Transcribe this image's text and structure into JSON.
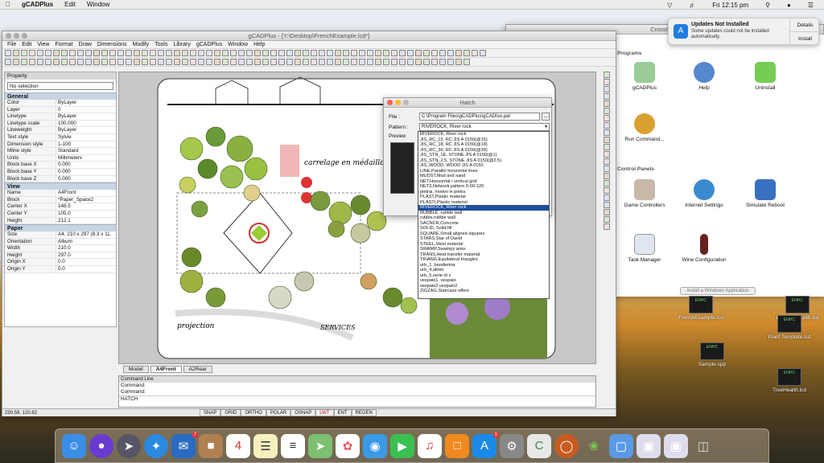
{
  "menubar": {
    "app_name": "gCADPlus",
    "items": [
      "Edit",
      "Window"
    ],
    "clock": "Fri 12:15 pm"
  },
  "notification": {
    "title": "Updates Not Installed",
    "body": "Some updates could not be installed automatically.",
    "details_label": "Details",
    "install_label": "Install"
  },
  "crossover": {
    "title": "CrossOver",
    "section_programs": "Programs",
    "section_control": "Control Panels",
    "programs": [
      "gCADPlus",
      "Help",
      "Uninstall",
      "Run Command..."
    ],
    "controls": [
      "Game Controllers",
      "Internet Settings",
      "Simulate Reboot",
      "Task Manager",
      "Wine Configuration"
    ],
    "install_button": "Install a Windows Application"
  },
  "desktop_files": [
    "FrenchExample.lcd",
    "PlanFromKeith.lcd",
    "Plant Template.lcd",
    "Sample.spp",
    "TreeHealth.lcd"
  ],
  "cad": {
    "title": "gCADPlus - [Y:\\Desktop\\FrenchExample.lcd*]",
    "menus": [
      "File",
      "Edit",
      "View",
      "Format",
      "Draw",
      "Dimensions",
      "Modify",
      "Tools",
      "Library",
      "gCADPlus",
      "Window",
      "Help"
    ],
    "property_title": "Property",
    "selection": "No selection",
    "general_title": "General",
    "general_rows": [
      {
        "k": "Color",
        "v": "ByLayer"
      },
      {
        "k": "Layer",
        "v": "0"
      },
      {
        "k": "Linetype",
        "v": "ByLayer"
      },
      {
        "k": "Linetype scale",
        "v": "100.000"
      },
      {
        "k": "Lineweight",
        "v": "ByLayer"
      },
      {
        "k": "Text style",
        "v": "Sylvie"
      },
      {
        "k": "Dimension style",
        "v": "1-100"
      },
      {
        "k": "Mline style",
        "v": "Standard"
      },
      {
        "k": "Units",
        "v": "Millimeters"
      },
      {
        "k": "Block base X",
        "v": "0.000"
      },
      {
        "k": "Block base Y",
        "v": "0.000"
      },
      {
        "k": "Block base Z",
        "v": "0.000"
      }
    ],
    "view_title": "View",
    "view_rows": [
      {
        "k": "Name",
        "v": "A4Front"
      },
      {
        "k": "Block",
        "v": "*Paper_Space2"
      },
      {
        "k": "Center X",
        "v": "148.5"
      },
      {
        "k": "Center Y",
        "v": "105.0"
      },
      {
        "k": "Height",
        "v": "212.1"
      }
    ],
    "paper_title": "Paper",
    "paper_rows": [
      {
        "k": "Size",
        "v": "A4, 210 x 297 (8.3 x 11."
      },
      {
        "k": "Orientation",
        "v": "Album"
      },
      {
        "k": "Width",
        "v": "210.0"
      },
      {
        "k": "Height",
        "v": "297.0"
      },
      {
        "k": "Origin X",
        "v": "0.0"
      },
      {
        "k": "Origin Y",
        "v": "0.0"
      }
    ],
    "tabs": [
      "Model",
      "A4Front",
      "A2Rear"
    ],
    "command_title": "Command Line",
    "command_lines": [
      "Command:",
      "Command:"
    ],
    "command_last": "HATCH",
    "coords": "230.58, 120.82",
    "status": [
      "SNAP",
      "GRID",
      "ORTHO",
      "POLAR",
      "OSNAP",
      "LWT",
      "ENT",
      "REGEN"
    ],
    "annotation_1": "carrelage en médaillon",
    "annotation_2": "projection",
    "annotation_3": "SERVICES"
  },
  "hatch": {
    "title": "Hatch",
    "file_label": "File :",
    "file_value": "C:\\Program Files\\gCADPlus\\gCADIso.pat",
    "pattern_label": "Pattern :",
    "pattern_value": "RIVEROCK, River rock",
    "preview_label": "Preview",
    "browse": "...",
    "patterns": [
      "RIVEROCK, River rock",
      "JIS_RC_15, RC JIS A 0150(@15)",
      "JIS_RC_18, RC JIS A 0150(@18)",
      "JIS_RC_30, RC JIS A 0150(@30)",
      "JIS_STN_1E, STONE JIS A 0150(@1)",
      "JIS_STN_2.5, STONE JIS A 0150(@2.5)",
      "JIS_WOOD, WOOD JIS A 0150",
      "LINE,Parallel horizontal lines",
      "MUDST,Mud and sand",
      "NET,Horizontal / vertical grid",
      "NET3,Network pattern 0-60-120",
      "pietrai, motivo in pietra",
      "PLAST,Plastic material",
      "PLASTI,Plastic material",
      "RIVEROCK, River rock",
      "RUBBLE, rubble wall",
      "rubble,rubble wall",
      "SACNCR,Concrete",
      "SOLID, Solid fill",
      "SQUARE,Small aligned squares",
      "STARS,Star of David",
      "STEEL,Steel material",
      "SWAMP,Swampy area",
      "TRANS,Heat transfer material",
      "TRIANG,Equilateral triangles",
      "urb_1, bandierina",
      "urb_4,alberi",
      "urb_5,serie di x",
      "vespaio1, vespaio",
      "vespaio2,vespaio2",
      "ZIGZAG,Staircase effect"
    ],
    "selected_index": 14
  }
}
